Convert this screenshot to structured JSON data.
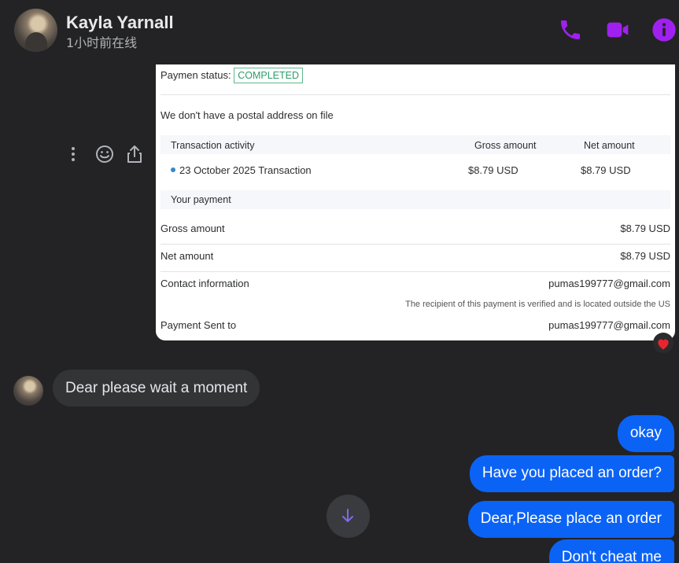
{
  "header": {
    "name": "Kayla Yarnall",
    "status": "1小时前在线",
    "accent": "#a020f0"
  },
  "message_actions": [
    "more-vertical-icon",
    "emoji-icon",
    "share-icon"
  ],
  "receipt": {
    "status_label": "Paymen status:",
    "status_value": "COMPLETED",
    "postal_note": "We don't have a postal address on file",
    "table_headers": [
      "Transaction activity",
      "Gross amount",
      "Net amount"
    ],
    "transaction": {
      "label": "23 October 2025 Transaction",
      "gross": "$8.79 USD",
      "net": "$8.79 USD"
    },
    "your_payment": "Your payment",
    "gross_label": "Gross amount",
    "gross_value": "$8.79 USD",
    "net_label": "Net amount",
    "net_value": "$8.79 USD",
    "contact_label": "Contact information",
    "contact_value": "pumas199777@gmail.com",
    "recipient_note": "The recipient of this payment is verified and is located outside the US",
    "sent_label": "Payment Sent to",
    "sent_value": "pumas199777@gmail.com"
  },
  "reaction": "heart-icon",
  "messages": {
    "incoming": [
      {
        "text": "Dear please wait a moment"
      }
    ],
    "outgoing": [
      {
        "text": "okay"
      },
      {
        "text": "Have you placed an order?"
      },
      {
        "text": "Dear,Please place an order"
      },
      {
        "text": "Don't cheat me"
      }
    ]
  },
  "colors": {
    "background": "#232325",
    "outgoing_bubble": "#0b63f6",
    "incoming_bubble": "#333436"
  }
}
